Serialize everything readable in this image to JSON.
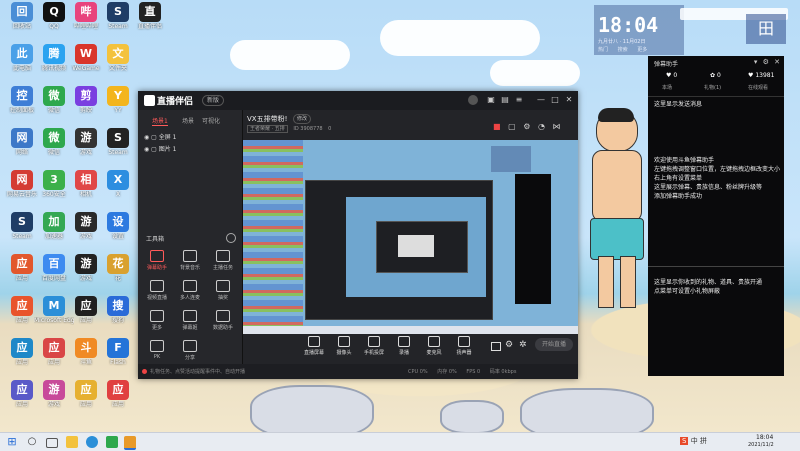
{
  "desktop": {
    "icons": [
      {
        "label": "回收站",
        "color": "#4a8ed6",
        "col": 0,
        "row": 0
      },
      {
        "label": "QQ",
        "color": "#111111",
        "col": 1,
        "row": 0
      },
      {
        "label": "哔哩哔哩",
        "color": "#e8447d",
        "col": 2,
        "row": 0
      },
      {
        "label": "Steam",
        "color": "#1f3d66",
        "col": 3,
        "row": 0
      },
      {
        "label": "直播伴侣",
        "color": "#222222",
        "col": 4,
        "row": 0
      },
      {
        "label": "此电脑",
        "color": "#4aa0e8",
        "col": 0,
        "row": 1
      },
      {
        "label": "腾讯视频",
        "color": "#2aa3f0",
        "col": 1,
        "row": 1
      },
      {
        "label": "WeGame",
        "color": "#d9362b",
        "col": 2,
        "row": 1
      },
      {
        "label": "文件夹",
        "color": "#f3c23d",
        "col": 3,
        "row": 1
      },
      {
        "label": "控制面板",
        "color": "#3e7ed6",
        "col": 0,
        "row": 2
      },
      {
        "label": "微信",
        "color": "#2ea84d",
        "col": 1,
        "row": 2
      },
      {
        "label": "剪映",
        "color": "#7a3fe0",
        "col": 2,
        "row": 2
      },
      {
        "label": "YY",
        "color": "#f3b51e",
        "col": 3,
        "row": 2
      },
      {
        "label": "网络",
        "color": "#3c78c8",
        "col": 0,
        "row": 3
      },
      {
        "label": "微信",
        "color": "#2ea84d",
        "col": 1,
        "row": 3
      },
      {
        "label": "游戏",
        "color": "#333333",
        "col": 2,
        "row": 3
      },
      {
        "label": "Steam",
        "color": "#222222",
        "col": 3,
        "row": 3
      },
      {
        "label": "网易云音乐",
        "color": "#d43c33",
        "col": 0,
        "row": 4
      },
      {
        "label": "360安全",
        "color": "#3cb04a",
        "col": 1,
        "row": 4
      },
      {
        "label": "相机",
        "color": "#e04848",
        "col": 2,
        "row": 4
      },
      {
        "label": "X",
        "color": "#2d8ee0",
        "col": 3,
        "row": 4
      },
      {
        "label": "Steam",
        "color": "#1f3d66",
        "col": 0,
        "row": 5
      },
      {
        "label": "加速器",
        "color": "#34a853",
        "col": 1,
        "row": 5
      },
      {
        "label": "游戏",
        "color": "#2a2a2a",
        "col": 2,
        "row": 5
      },
      {
        "label": "设置",
        "color": "#2d7ae0",
        "col": 3,
        "row": 5
      },
      {
        "label": "应用",
        "color": "#e2572d",
        "col": 0,
        "row": 6
      },
      {
        "label": "百度网盘",
        "color": "#3d8bf0",
        "col": 1,
        "row": 6
      },
      {
        "label": "游戏",
        "color": "#222222",
        "col": 2,
        "row": 6
      },
      {
        "label": "花",
        "color": "#d9a12f",
        "col": 3,
        "row": 6
      },
      {
        "label": "应用",
        "color": "#e9542c",
        "col": 0,
        "row": 7
      },
      {
        "label": "Microsoft Edge",
        "color": "#2b8fd8",
        "col": 1,
        "row": 7
      },
      {
        "label": "应用",
        "color": "#202020",
        "col": 2,
        "row": 7
      },
      {
        "label": "搜狗",
        "color": "#2a6bd8",
        "col": 3,
        "row": 7
      },
      {
        "label": "应用",
        "color": "#1e88c8",
        "col": 0,
        "row": 8
      },
      {
        "label": "应用",
        "color": "#d94646",
        "col": 1,
        "row": 8
      },
      {
        "label": "斗鱼",
        "color": "#f08a24",
        "col": 2,
        "row": 8
      },
      {
        "label": "Flash",
        "color": "#2474d8",
        "col": 3,
        "row": 8
      },
      {
        "label": "应用",
        "color": "#5a5ac8",
        "col": 0,
        "row": 9
      },
      {
        "label": "游戏",
        "color": "#c84a9a",
        "col": 1,
        "row": 9
      },
      {
        "label": "应用",
        "color": "#e6b030",
        "col": 2,
        "row": 9
      },
      {
        "label": "应用",
        "color": "#e04040",
        "col": 3,
        "row": 9
      }
    ]
  },
  "app": {
    "logo": "直播伴侣",
    "version_badge": "新版",
    "window_buttons": [
      "—",
      "□",
      "✕"
    ],
    "tabs": [
      "场景1",
      "场景",
      "可视化"
    ],
    "sources": [
      "全屏 1",
      "图片 1"
    ],
    "tools_header": "工具箱",
    "tools": [
      {
        "label": "弹幕助手",
        "active": true
      },
      {
        "label": "背景音乐"
      },
      {
        "label": "主播任务"
      },
      {
        "label": "视频直播"
      },
      {
        "label": "多人连麦"
      },
      {
        "label": "抽奖"
      },
      {
        "label": "更多"
      },
      {
        "label": "弹幕姬"
      },
      {
        "label": "数据助手"
      },
      {
        "label": "PK"
      },
      {
        "label": "分享"
      }
    ],
    "stream_title": "VX五排带粉!",
    "stream_title_badge": "修改",
    "stream_meta": [
      "王者荣耀 · 五排",
      "ID 3908778",
      "0"
    ],
    "controls": [
      "直播屏幕",
      "摄像头",
      "手机投屏",
      "录播",
      "麦克风",
      "扬声器"
    ],
    "start_button": "开始直播",
    "status_left": "礼物任务、点赞活动提醒事件中、自动开播",
    "status_right": [
      "CPU 0%",
      "内存 0%",
      "FPS 0",
      "码率 0kbps"
    ]
  },
  "right_panel": {
    "title": "弹幕助手",
    "stats": [
      {
        "label": "粉丝",
        "value": "0"
      },
      {
        "label": "礼物",
        "value": "0"
      },
      {
        "label": "观看",
        "value": "13981"
      }
    ],
    "stat_tabs": [
      "本场",
      "礼物(1)",
      "在线观看"
    ],
    "line1": "这里显示发送消息",
    "help": "欢迎使用斗鱼弹幕助手\n左键拖拽调整窗口位置，左键拖拽边框改变大小\n右上角有设置菜单\n这里展示弹幕、贵族信息、粉丝牌升级等\n添加弹幕助手成功",
    "line2": "这里显示你收到的礼物、道具、贵族开通\n点菜单可设置小礼物屏蔽"
  },
  "clock": {
    "time": "18:04",
    "date": "九月廿八 · 11月02日",
    "chips": [
      "热门",
      "搜索",
      "更多"
    ]
  },
  "taskbar": {
    "time": "18:04",
    "date": "2021/11/2",
    "tray": [
      "S",
      "中",
      "拼"
    ]
  }
}
